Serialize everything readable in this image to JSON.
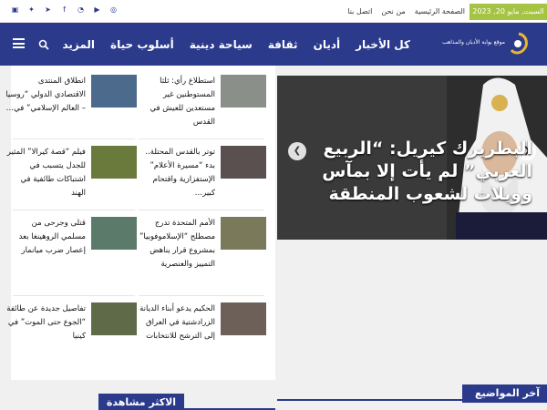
{
  "topbar": {
    "date": "السبت, مايو 20, 2023",
    "links": [
      "الصفحة الرئيسية",
      "من نحن",
      "اتصل بنا"
    ],
    "socials": [
      "vk-icon",
      "twitter-icon",
      "telegram-icon",
      "facebook-icon",
      "rss-icon",
      "youtube-icon",
      "instagram-icon"
    ]
  },
  "nav": {
    "logo_text": "موقع بوابة الأديان والمذاهب",
    "menu": [
      "كل الأخبار",
      "أديان",
      "ثقافة",
      "سياحة دينية",
      "أسلوب حياة",
      "المزيد"
    ]
  },
  "slider": {
    "title": "البطريرك كيريل: “الربيع العربي” لم يأت إلا بمآس وويلات لشعوب المنطقة"
  },
  "news": [
    {
      "text": "استطلاع رأي: ثلثا المستوطنين غير مستعدين للعيش في القدس",
      "thumb": "#8a8f8a"
    },
    {
      "text": "انطلاق المنتدى الاقتصادي الدولي “روسيا – العالم الإسلامي” في…",
      "thumb": "#4b6a8c"
    },
    {
      "text": "توتر بالقدس المحتلة.. بدء “مسيرة الأعلام” الإستفزازية واقتحام كبير…",
      "thumb": "#5a5050"
    },
    {
      "text": "فيلم “قصة كيرالا” المثير للجدل يتسبب في اشتباكات طائفية في الهند",
      "thumb": "#6a7a3c"
    },
    {
      "text": "الأمم المتحدة تدرج مصطلح “الإسلاموفوبيا” بمشروع قرار يناهض التمييز والعنصرية",
      "thumb": "#7a7a5a"
    },
    {
      "text": "قتلى وجرحى من مسلمي الروهينغا بعد إعصار ضرب ميانمار",
      "thumb": "#5c7a6a"
    },
    {
      "text": "الحكيم يدعو أبناء الديانة الزرادشتية في العراق إلى الترشح للانتخابات",
      "thumb": "#6c6058"
    },
    {
      "text": "تفاصيل جديدة عن طائفة “الجوع حتى الموت” في كينيا",
      "thumb": "#5e6a48"
    }
  ],
  "sections": {
    "latest": "آخر المواضيع",
    "most_viewed": "الاكثر مشاهدة"
  },
  "colors": {
    "primary": "#2c3a8c",
    "date_badge": "#a6c444"
  }
}
